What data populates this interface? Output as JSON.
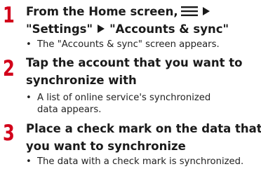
{
  "steps": [
    {
      "number": "1",
      "title_line1_text": "From the Home screen,",
      "title_line1_icons": [
        "menu-lines-icon",
        "right-triangle-icon"
      ],
      "title_line2_part1": "\"Settings\"",
      "title_line2_icon": "right-triangle-icon",
      "title_line2_part2": "\"Accounts & sync\"",
      "note_bullet": "•",
      "note_line1": "The \"Accounts & sync\" screen appears."
    },
    {
      "number": "2",
      "title_line1": "Tap the account that you want to",
      "title_line2": "synchronize with",
      "note_bullet": "•",
      "note_line1": "A list of online service's synchronized",
      "note_line2": "data appears."
    },
    {
      "number": "3",
      "title_line1": "Place a check mark on the data that",
      "title_line2": "you want to synchronize",
      "note_bullet": "•",
      "note_line1": "The data with a check mark is synchronized."
    }
  ],
  "colors": {
    "step_number": "#d2001a",
    "text": "#1a1a1a"
  }
}
